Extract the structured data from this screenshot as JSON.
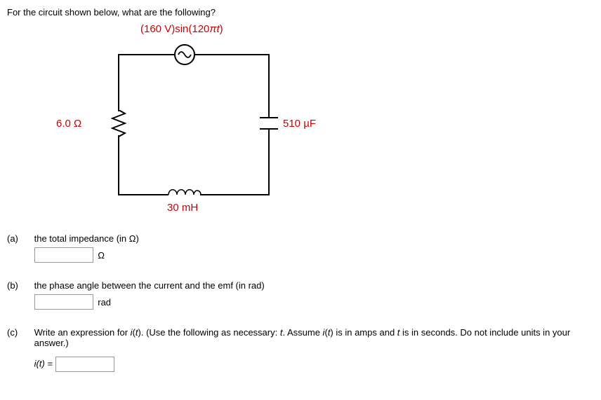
{
  "question_intro": "For the circuit shown below, what are the following?",
  "circuit": {
    "source_formula": "(160 V)sin(120πt)",
    "resistor": "6.0 Ω",
    "capacitor": "510 µF",
    "inductor": "30 mH"
  },
  "parts": {
    "a": {
      "label": "(a)",
      "text": "the total impedance (in Ω)",
      "unit": "Ω"
    },
    "b": {
      "label": "(b)",
      "text": "the phase angle between the current and the emf (in rad)",
      "unit": "rad"
    },
    "c": {
      "label": "(c)",
      "text": "Write an expression for i(t). (Use the following as necessary: t. Assume i(t) is in amps and t is in seconds. Do not include units in your answer.)",
      "var_label": "i(t) ="
    }
  }
}
